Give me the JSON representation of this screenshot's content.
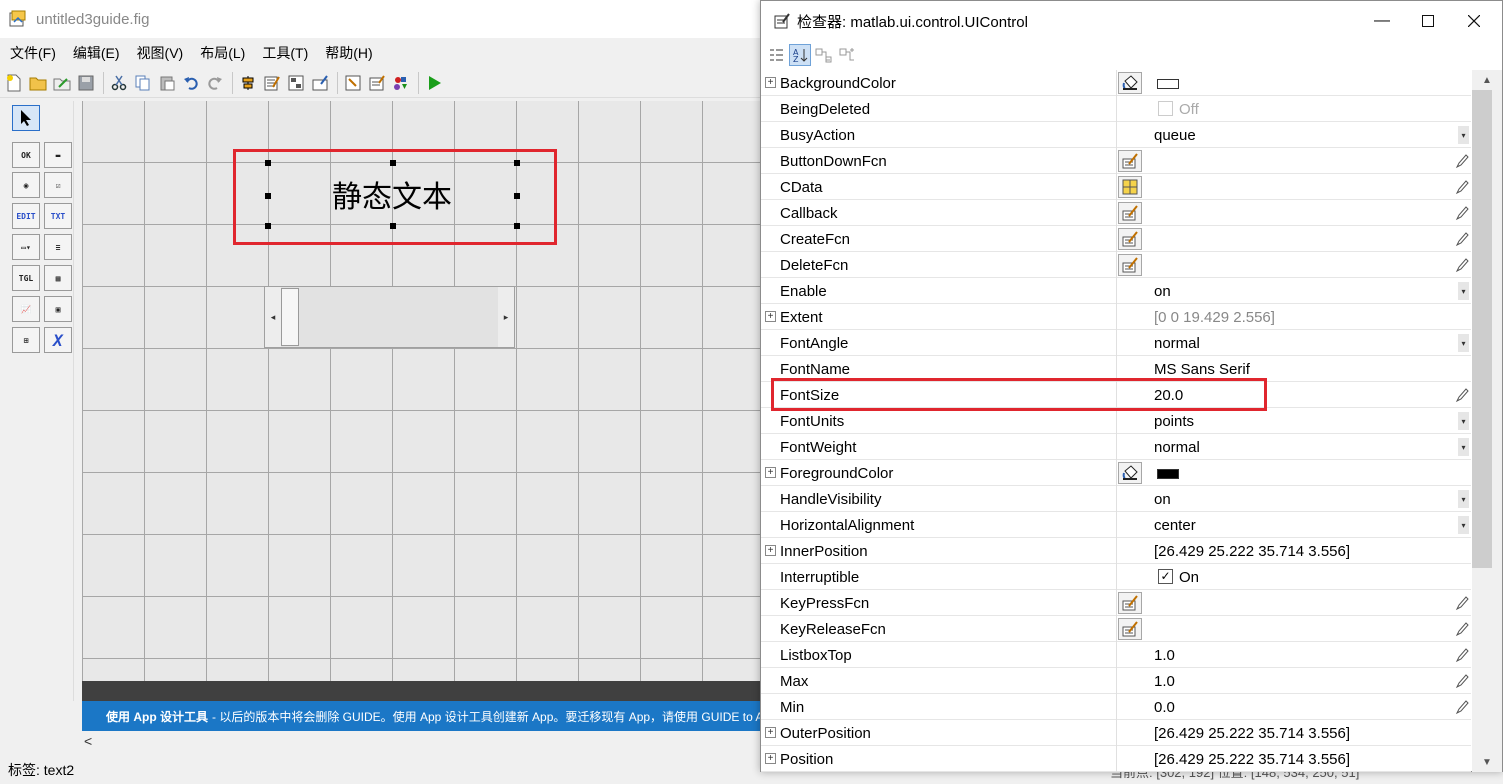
{
  "guide": {
    "title": "untitled3guide.fig",
    "menu": [
      "文件(F)",
      "编辑(E)",
      "视图(V)",
      "布局(L)",
      "工具(T)",
      "帮助(H)"
    ],
    "canvas": {
      "static_text": "静态文本"
    },
    "info_bar": {
      "bold": "使用 App 设计工具",
      "text": " - 以后的版本中将会删除 GUIDE。使用 App 设计工具创建新 App。要迁移现有 App，请使用 GUIDE to A"
    },
    "hscroll_left": "<",
    "status_label": "标签: text2",
    "status_extra": "当前点: [302, 192]      位置: [148, 534, 250, 51]"
  },
  "palette": [
    {
      "name": "select-tool-icon",
      "label": "",
      "selected": true
    },
    {
      "name": "pushbutton-tool-icon",
      "label": "OK"
    },
    {
      "name": "slider-tool-icon",
      "label": "▬"
    },
    {
      "name": "radiobutton-tool-icon",
      "label": "◉"
    },
    {
      "name": "checkbox-tool-icon",
      "label": "☑"
    },
    {
      "name": "edit-text-tool-icon",
      "label": "EDIT"
    },
    {
      "name": "static-text-tool-icon",
      "label": "TXT"
    },
    {
      "name": "popup-menu-tool-icon",
      "label": "▭▾"
    },
    {
      "name": "listbox-tool-icon",
      "label": "≡"
    },
    {
      "name": "toggle-button-tool-icon",
      "label": "TGL"
    },
    {
      "name": "table-tool-icon",
      "label": "▦"
    },
    {
      "name": "axes-tool-icon",
      "label": "📈"
    },
    {
      "name": "panel-tool-icon",
      "label": "▣"
    },
    {
      "name": "button-group-tool-icon",
      "label": "⊞"
    },
    {
      "name": "activex-tool-icon",
      "label": "X"
    }
  ],
  "inspector": {
    "title": "检查器:  matlab.ui.control.UIControl",
    "properties": [
      {
        "name": "BackgroundColor",
        "expand": true,
        "btn": "color",
        "swatch": "#ffffff"
      },
      {
        "name": "BeingDeleted",
        "checkbox": false,
        "check_label": "Off",
        "disabled": true
      },
      {
        "name": "BusyAction",
        "value": "queue",
        "dropdown": true
      },
      {
        "name": "ButtonDownFcn",
        "btn": "callback",
        "pen": true
      },
      {
        "name": "CData",
        "btn": "grid",
        "pen": true
      },
      {
        "name": "Callback",
        "btn": "callback",
        "pen": true
      },
      {
        "name": "CreateFcn",
        "btn": "callback",
        "pen": true
      },
      {
        "name": "DeleteFcn",
        "btn": "callback",
        "pen": true
      },
      {
        "name": "Enable",
        "value": "on",
        "dropdown": true
      },
      {
        "name": "Extent",
        "expand": true,
        "value": "[0 0 19.429 2.556]",
        "gray": true
      },
      {
        "name": "FontAngle",
        "value": "normal",
        "dropdown": true
      },
      {
        "name": "FontName",
        "value": "MS Sans Serif"
      },
      {
        "name": "FontSize",
        "value": "20.0",
        "pen": true
      },
      {
        "name": "FontUnits",
        "value": "points",
        "dropdown": true
      },
      {
        "name": "FontWeight",
        "value": "normal",
        "dropdown": true
      },
      {
        "name": "ForegroundColor",
        "expand": true,
        "btn": "color",
        "swatch": "#000000"
      },
      {
        "name": "HandleVisibility",
        "value": "on",
        "dropdown": true
      },
      {
        "name": "HorizontalAlignment",
        "value": "center",
        "dropdown": true
      },
      {
        "name": "InnerPosition",
        "expand": true,
        "value": "[26.429 25.222 35.714 3.556]"
      },
      {
        "name": "Interruptible",
        "checkbox": true,
        "check_label": "On"
      },
      {
        "name": "KeyPressFcn",
        "btn": "callback",
        "pen": true
      },
      {
        "name": "KeyReleaseFcn",
        "btn": "callback",
        "pen": true
      },
      {
        "name": "ListboxTop",
        "value": "1.0",
        "pen": true
      },
      {
        "name": "Max",
        "value": "1.0",
        "pen": true
      },
      {
        "name": "Min",
        "value": "0.0",
        "pen": true
      },
      {
        "name": "OuterPosition",
        "expand": true,
        "value": "[26.429 25.222 35.714 3.556]"
      },
      {
        "name": "Position",
        "expand": true,
        "value": "[26.429 25.222 35.714 3.556]"
      }
    ]
  },
  "colors": {
    "highlight_box": "#e0262e",
    "info_bar_bg": "#1b77c6"
  }
}
